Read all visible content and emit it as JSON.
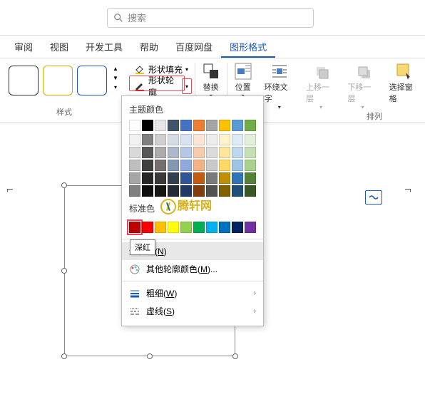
{
  "search": {
    "placeholder": "搜索"
  },
  "tabs": [
    "审阅",
    "视图",
    "开发工具",
    "帮助",
    "百度网盘",
    "图形格式"
  ],
  "active_tab": "图形格式",
  "ribbon": {
    "style_label": "样式",
    "fill_label": "形状填充",
    "outline_label": "形状轮廓",
    "replace_label": "替换",
    "position_label": "位置",
    "wrap_label": "环绕文字",
    "bring_forward": "上移一层",
    "send_backward": "下移一层",
    "selection_pane": "选择窗格",
    "arrange_label": "排列"
  },
  "dropdown": {
    "theme_colors": "主题颜色",
    "standard_colors": "标准色",
    "no_outline": "无轮廓(N)",
    "more_colors": "其他轮廓颜色(M)...",
    "weight": "粗细(W)",
    "dashes": "虚线(S)",
    "selected_tooltip": "深红",
    "theme_row1": [
      "#ffffff",
      "#000000",
      "#e7e6e6",
      "#44546a",
      "#4472c4",
      "#ed7d31",
      "#a5a5a5",
      "#ffc000",
      "#5b9bd5",
      "#70ad47"
    ],
    "theme_tints": [
      [
        "#f2f2f2",
        "#808080",
        "#d0cece",
        "#d6dce5",
        "#d9e2f3",
        "#fbe5d6",
        "#ededed",
        "#fff2cc",
        "#deebf7",
        "#e2f0d9"
      ],
      [
        "#d9d9d9",
        "#595959",
        "#aeabab",
        "#adb9ca",
        "#b4c7e7",
        "#f7cbac",
        "#dbdbdb",
        "#ffe699",
        "#bdd7ee",
        "#c5e0b4"
      ],
      [
        "#bfbfbf",
        "#404040",
        "#757070",
        "#8497b0",
        "#8eaadb",
        "#f4b183",
        "#c9c9c9",
        "#ffd966",
        "#9dc3e6",
        "#a9d18e"
      ],
      [
        "#a6a6a6",
        "#262626",
        "#3a3838",
        "#323f4f",
        "#2f5597",
        "#c55a11",
        "#7b7b7b",
        "#bf9000",
        "#2e75b6",
        "#548235"
      ],
      [
        "#808080",
        "#0d0d0d",
        "#171616",
        "#222a35",
        "#1f3864",
        "#833c0c",
        "#525252",
        "#806000",
        "#1f4e79",
        "#385723"
      ]
    ],
    "standard_row": [
      "#c00000",
      "#ff0000",
      "#ffc000",
      "#ffff00",
      "#92d050",
      "#00b050",
      "#00b0f0",
      "#0070c0",
      "#002060",
      "#7030a0"
    ]
  }
}
